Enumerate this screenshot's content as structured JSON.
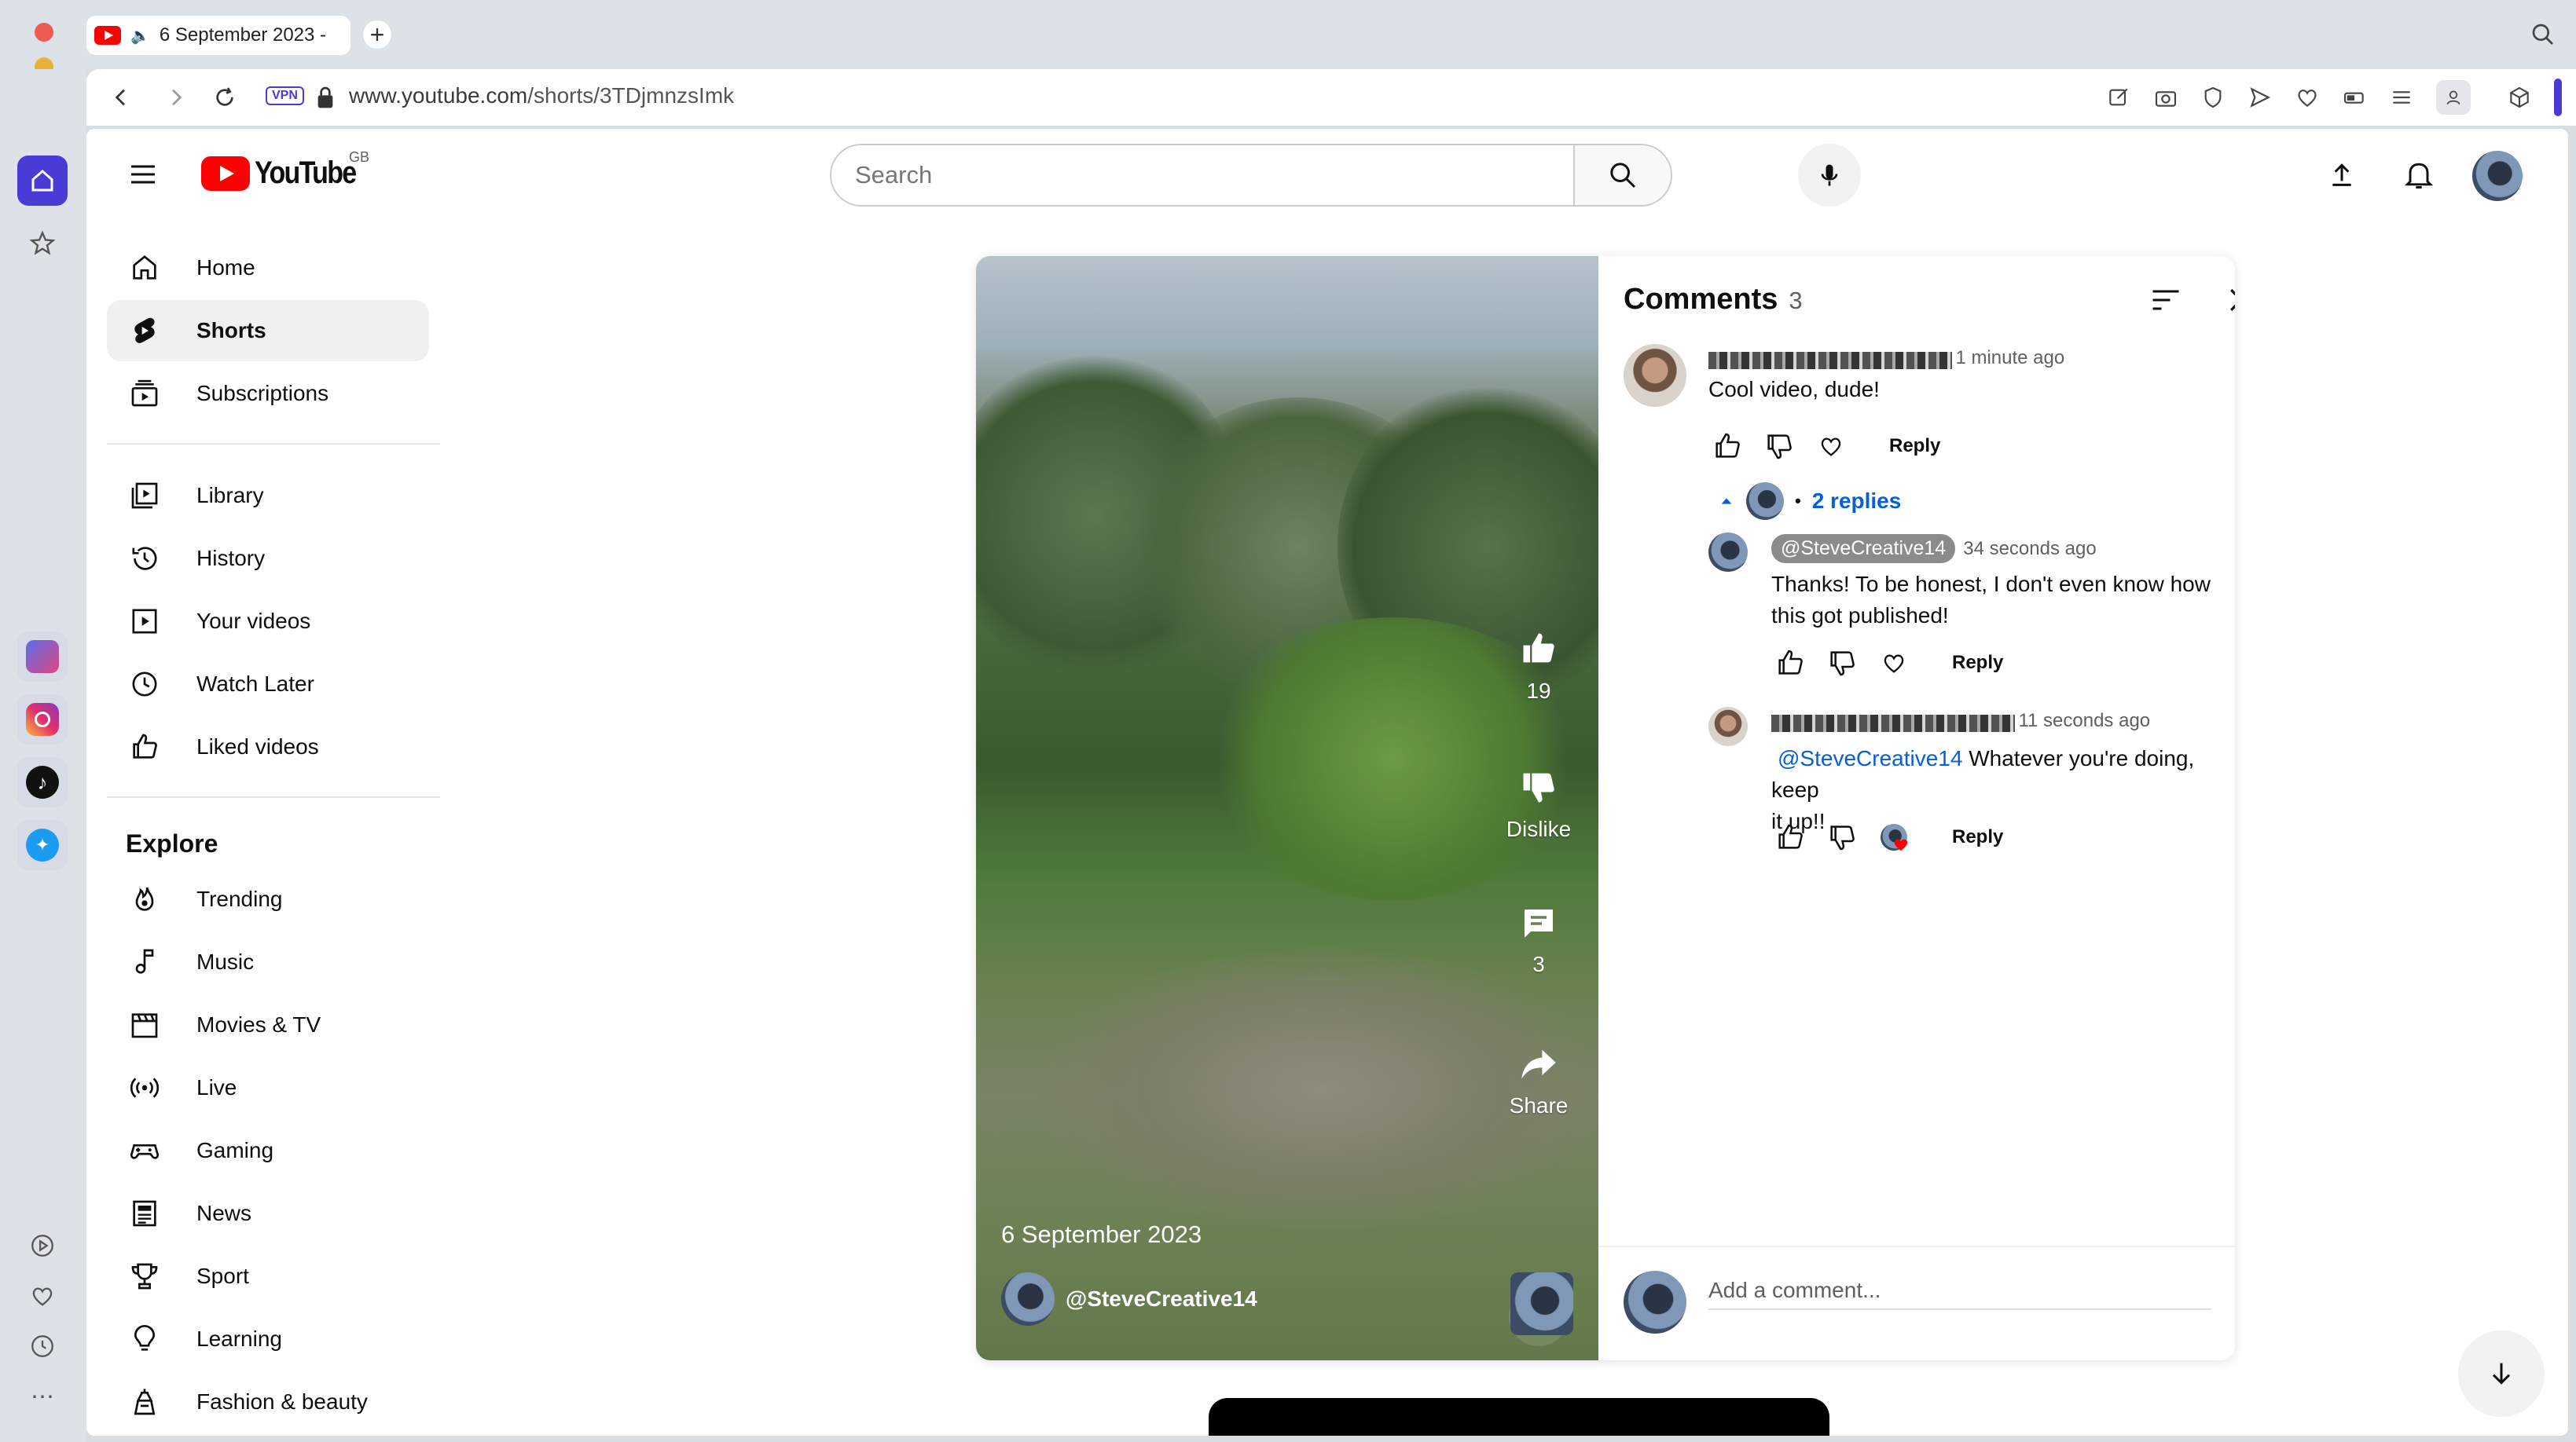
{
  "browser": {
    "tab_title": "6 September 2023 -",
    "url_domain": "www.youtube.com",
    "url_path": "/shorts/3TDjmnzsImk",
    "vpn_label": "VPN"
  },
  "header": {
    "logo_text": "YouTube",
    "region": "GB",
    "search_placeholder": "Search"
  },
  "sidebar": {
    "primary": [
      {
        "label": "Home",
        "icon": "home-icon"
      },
      {
        "label": "Shorts",
        "icon": "shorts-icon",
        "active": true
      },
      {
        "label": "Subscriptions",
        "icon": "subscriptions-icon"
      }
    ],
    "library": [
      {
        "label": "Library",
        "icon": "library-icon"
      },
      {
        "label": "History",
        "icon": "history-icon"
      },
      {
        "label": "Your videos",
        "icon": "your-videos-icon"
      },
      {
        "label": "Watch Later",
        "icon": "clock-icon"
      },
      {
        "label": "Liked videos",
        "icon": "thumbs-up-icon"
      }
    ],
    "explore_title": "Explore",
    "explore": [
      {
        "label": "Trending",
        "icon": "trending-icon"
      },
      {
        "label": "Music",
        "icon": "music-icon"
      },
      {
        "label": "Movies & TV",
        "icon": "clapper-icon"
      },
      {
        "label": "Live",
        "icon": "live-icon"
      },
      {
        "label": "Gaming",
        "icon": "gamepad-icon"
      },
      {
        "label": "News",
        "icon": "news-icon"
      },
      {
        "label": "Sport",
        "icon": "trophy-icon"
      },
      {
        "label": "Learning",
        "icon": "bulb-icon"
      },
      {
        "label": "Fashion & beauty",
        "icon": "hanger-icon"
      }
    ]
  },
  "video": {
    "title": "6 September 2023",
    "channel": "@SteveCreative14",
    "like_count": "19",
    "dislike_label": "Dislike",
    "comment_count": "3",
    "share_label": "Share"
  },
  "comments": {
    "title": "Comments",
    "count": "3",
    "reply_label": "Reply",
    "replies_toggle": "2 replies",
    "add_placeholder": "Add a comment...",
    "items": [
      {
        "time": "1 minute ago",
        "text": "Cool video, dude!"
      },
      {
        "author": "@SteveCreative14",
        "time": "34 seconds ago",
        "text_line1": "Thanks! To be honest, I don't even know how",
        "text_line2": "this got published!"
      },
      {
        "time": "11 seconds ago",
        "mention": "@SteveCreative14",
        "text_line1": " Whatever you're doing, keep",
        "text_line2": "it up!!"
      }
    ]
  },
  "colors": {
    "youtube_red": "#ff0000",
    "link_blue": "#065fd4",
    "browser_accent": "#4b3bd6"
  }
}
